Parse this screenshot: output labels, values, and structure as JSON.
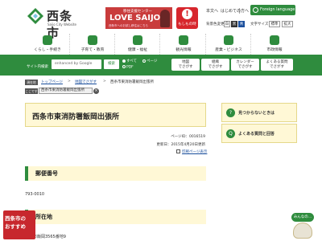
{
  "header": {
    "site_name": "西条市",
    "site_subtitle": "Saijo City Website",
    "banner": {
      "top": "移住支援センター",
      "main": "LOVE SAIJO",
      "foot": "西条市へのお試し移住はこちら"
    },
    "emergency_label": "もしもの時",
    "utility_links": [
      "本文へ",
      "はじめての方へ"
    ],
    "foreign_language": "Foreign language",
    "bg_color_label": "背景色変更",
    "bg_chip_labels": [
      "白",
      "黒",
      "青"
    ],
    "text_size_label": "文字サイズ",
    "text_size_chips": [
      "標準",
      "拡大"
    ]
  },
  "nav": {
    "items": [
      {
        "label": "くらし・手続き",
        "icon": "house-icon"
      },
      {
        "label": "子育て・教育",
        "icon": "family-icon"
      },
      {
        "label": "健康・福祉",
        "icon": "heart-icon"
      },
      {
        "label": "観光情報",
        "icon": "mountain-icon"
      },
      {
        "label": "産業・ビジネス",
        "icon": "building-icon"
      },
      {
        "label": "市政情報",
        "icon": "city-hall-icon"
      }
    ]
  },
  "search": {
    "caption": "サイト内検索",
    "placeholder": "enhanced by Google",
    "button": "検索",
    "options": [
      "すべて",
      "ページ",
      "PDF"
    ],
    "quick_buttons": [
      [
        "地図",
        "でさがす"
      ],
      [
        "組織",
        "でさがす"
      ],
      [
        "カレンダー",
        "でさがす"
      ],
      [
        "よくある質問",
        "でさがす"
      ]
    ]
  },
  "breadcrumb": {
    "tag_now": "現在地",
    "tag_here": "ここです",
    "items": [
      "トップページ",
      "地図でさがす",
      "西条市東消防署飯岡出張所"
    ],
    "here_box": "西条市東消防署飯岡出張所"
  },
  "page": {
    "title": "西条市東消防署飯岡出張所",
    "page_id": "ページID：0016519",
    "updated": "更新日：2015年4月20日更新",
    "print_link": "印刷ページ表示"
  },
  "sections": [
    {
      "heading": "郵便番号",
      "body": "793-0010"
    },
    {
      "heading": "所在地",
      "body": "西条市飯岡3565番地9"
    }
  ],
  "side": {
    "cards": [
      {
        "label": "見つからないときは",
        "icon": "?"
      },
      {
        "label": "よくある質問と回答",
        "icon": "Q"
      }
    ]
  },
  "widgets": {
    "recommend": [
      "西条市の",
      "おすすめ"
    ],
    "mascot_bubble": "みんなの…"
  },
  "colors": {
    "brand_green": "#2f8c3e",
    "emergency_red": "#d7262d",
    "title_bg": "#fff8d6"
  }
}
